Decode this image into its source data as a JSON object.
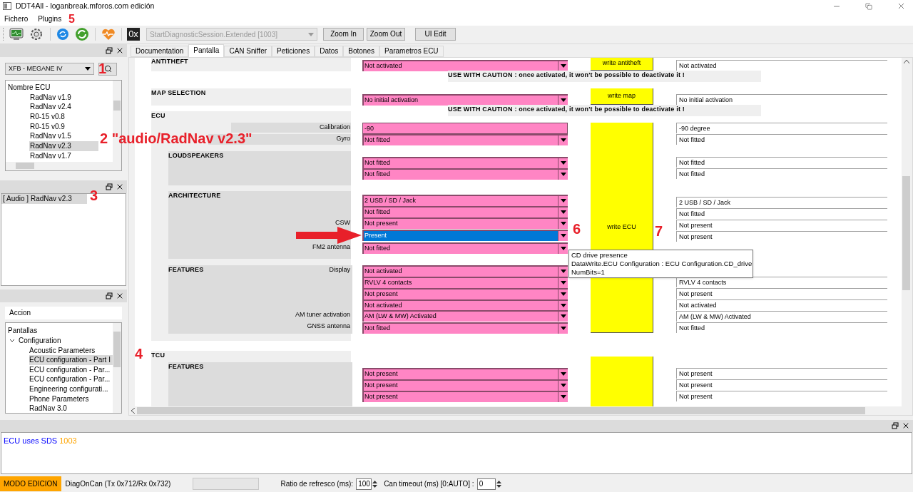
{
  "window": {
    "title": "DDT4All - loganbreak.mforos.com edición"
  },
  "menu": [
    "Fichero",
    "Plugins"
  ],
  "toolbar": {
    "hex_icon": "0x",
    "session_combo": "StartDiagnosticSession.Extended [1003]",
    "buttons": [
      "Zoom In",
      "Zoom Out",
      "UI Edit"
    ]
  },
  "ecu_panel": {
    "vehicle": "XFB - MEGANE IV",
    "list_header": "Nombre ECU",
    "items": [
      {
        "label": "RadNav v1.9",
        "selected": false
      },
      {
        "label": "RadNav v2.4",
        "selected": false
      },
      {
        "label": "R0-15 v0.8",
        "selected": false
      },
      {
        "label": "R0-15 v0.9",
        "selected": false
      },
      {
        "label": "RadNav v1.5",
        "selected": false
      },
      {
        "label": "RadNav v2.3",
        "selected": true
      },
      {
        "label": "RadNav v1.7",
        "selected": false
      }
    ]
  },
  "selected_panel": {
    "items": [
      {
        "label": "[ Audio ] RadNav v2.3",
        "selected": true
      }
    ]
  },
  "screens_panel": {
    "action": "Accion",
    "tree_header": "Pantallas",
    "tree": [
      {
        "label": "Configuration",
        "expanded": true,
        "children": [
          {
            "label": "Acoustic Parameters",
            "selected": false
          },
          {
            "label": "ECU configuration - Part I",
            "selected": true
          },
          {
            "label": "ECU configuration - Par...",
            "selected": false
          },
          {
            "label": "ECU configuration - Par...",
            "selected": false
          },
          {
            "label": "Engineering configurati...",
            "selected": false
          },
          {
            "label": "Phone Parameters",
            "selected": false
          },
          {
            "label": "RadNav 3.0",
            "selected": false
          }
        ]
      }
    ]
  },
  "tabs": [
    {
      "label": "Documentation",
      "selected": false
    },
    {
      "label": "Pantalla",
      "selected": true
    },
    {
      "label": "CAN Sniffer",
      "selected": false
    },
    {
      "label": "Peticiones",
      "selected": false
    },
    {
      "label": "Datos",
      "selected": false
    },
    {
      "label": "Botones",
      "selected": false
    },
    {
      "label": "Parametros ECU",
      "selected": false
    }
  ],
  "form": {
    "groups": [
      {
        "title": "ANTITHEFT",
        "kind": "outer"
      },
      {
        "title": "MAP SELECTION",
        "kind": "outer"
      },
      {
        "title": "ECU",
        "kind": "outer"
      },
      {
        "title": "LOUDSPEAKERS",
        "kind": "inner"
      },
      {
        "title": "ARCHITECTURE",
        "kind": "inner"
      },
      {
        "title": "FEATURES",
        "kind": "inner"
      },
      {
        "title": "TCU",
        "kind": "outer"
      },
      {
        "title": "FEATURES",
        "kind": "inner"
      }
    ],
    "labels": [
      "Calibration",
      "Gyro",
      "CSW",
      "FM2 antenna",
      "Display",
      "AM tuner activation",
      "GNSS antenna"
    ],
    "fields": [
      {
        "kind": "combo",
        "value": "Not activated",
        "selected": false
      },
      {
        "kind": "combo",
        "value": "No initial activation",
        "selected": false
      },
      {
        "kind": "input",
        "value": "-90",
        "selected": false
      },
      {
        "kind": "combo",
        "value": "Not fitted",
        "selected": false
      },
      {
        "kind": "combo",
        "value": "Not fitted",
        "selected": false
      },
      {
        "kind": "combo",
        "value": "Not fitted",
        "selected": false
      },
      {
        "kind": "combo",
        "value": "2 USB / SD / Jack",
        "selected": false
      },
      {
        "kind": "combo",
        "value": "Not fitted",
        "selected": false
      },
      {
        "kind": "combo",
        "value": "Not present",
        "selected": false
      },
      {
        "kind": "combo",
        "value": "Present",
        "selected": true
      },
      {
        "kind": "combo",
        "value": "Not fitted",
        "selected": false
      },
      {
        "kind": "combo",
        "value": "Not activated",
        "selected": false
      },
      {
        "kind": "combo",
        "value": "RVLV 4 contacts",
        "selected": false
      },
      {
        "kind": "combo",
        "value": "Not present",
        "selected": false
      },
      {
        "kind": "combo",
        "value": "Not activated",
        "selected": false
      },
      {
        "kind": "combo",
        "value": "AM (LW & MW) Activated",
        "selected": false
      },
      {
        "kind": "combo",
        "value": "Not fitted",
        "selected": false
      },
      {
        "kind": "combo",
        "value": "Not present",
        "selected": false
      },
      {
        "kind": "combo",
        "value": "Not present",
        "selected": false
      },
      {
        "kind": "combo",
        "value": "Not present",
        "selected": false
      }
    ],
    "buttons": [
      {
        "kind": "labeled",
        "label": "write antitheft"
      },
      {
        "kind": "labeled",
        "label": "write map"
      },
      {
        "kind": "labeled",
        "label": "write ECU"
      },
      {
        "kind": "blank"
      }
    ],
    "cautions": [
      "USE WITH CAUTION : once activated, it won't be possible to deactivate it !",
      "USE WITH CAUTION : once activated, it won't be possible to deactivate it !"
    ],
    "readouts": [
      "Not activated",
      "No initial activation",
      "-90 degree",
      "Not fitted",
      "Not fitted",
      "Not fitted",
      "2 USB / SD / Jack",
      "Not fitted",
      "Not present",
      "Not present",
      "RVLV 4 contacts",
      "Not present",
      "Not activated",
      "AM (LW & MW) Activated",
      "Not fitted",
      "Not present",
      "Not present",
      "Not present"
    ]
  },
  "tooltip": {
    "lines": [
      "CD drive presence",
      "DataWrite.ECU Configuration : ECU Configuration.CD_drive",
      "NumBits=1"
    ]
  },
  "log": [
    {
      "text": "ECU uses SDS",
      "color": "#0000ff"
    },
    {
      "text": "1003",
      "color": "#ffa500"
    }
  ],
  "status_bar": {
    "mode": "MODO EDICION",
    "protocol": "DiagOnCan (Tx 0x712/Rx 0x732)",
    "refresh_label": "Ratio de refresco (ms):",
    "refresh_value": "100",
    "timeout_label": "Can timeout (ms) [0:AUTO] :",
    "timeout_value": "0"
  },
  "annotations": [
    {
      "kind": "label",
      "text": "5"
    },
    {
      "kind": "label",
      "text": "1"
    },
    {
      "kind": "label",
      "text": "2 \"audio/RadNav v2.3\""
    },
    {
      "kind": "label",
      "text": "3"
    },
    {
      "kind": "arrow"
    },
    {
      "kind": "label",
      "text": "6"
    },
    {
      "kind": "label",
      "text": "7"
    },
    {
      "kind": "label",
      "text": "4"
    }
  ]
}
